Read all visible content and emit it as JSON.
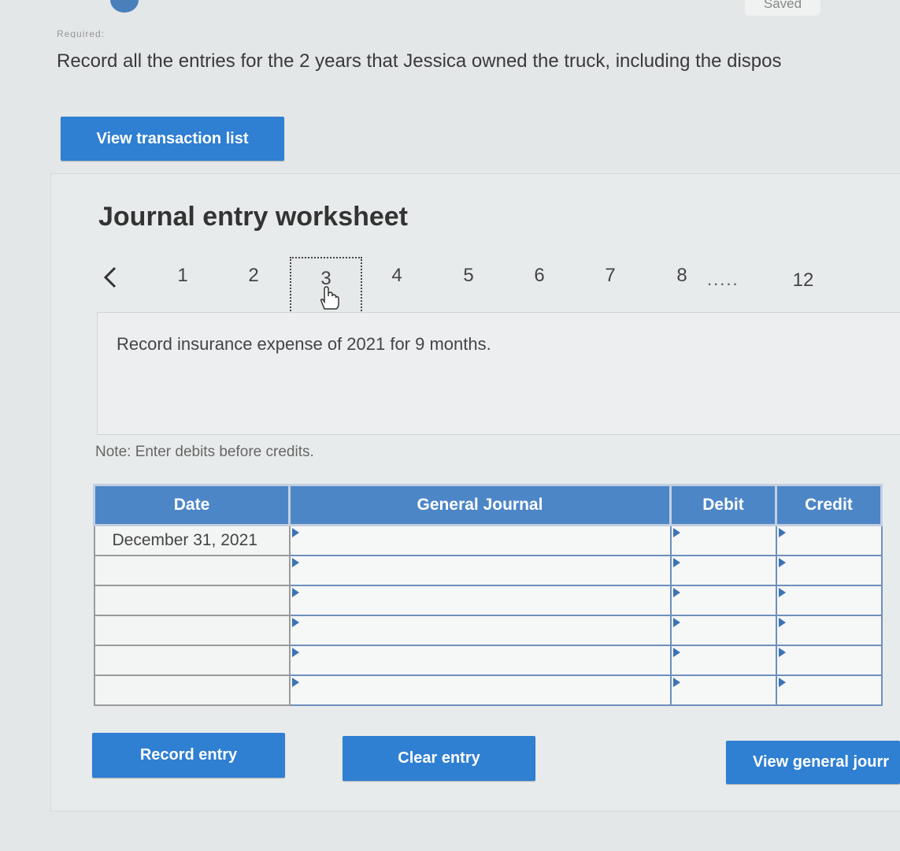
{
  "header": {
    "status": "Saved",
    "required_label": "Required:",
    "instruction": "Record all the entries for the 2 years that Jessica owned the truck, including the dispos"
  },
  "buttons": {
    "view_transaction_list": "View transaction list",
    "record_entry": "Record entry",
    "clear_entry": "Clear entry",
    "view_general_journal": "View general jourr"
  },
  "worksheet": {
    "title": "Journal entry worksheet",
    "pages": [
      "1",
      "2",
      "3",
      "4",
      "5",
      "6",
      "7",
      "8",
      "12"
    ],
    "active_page": "3",
    "ellipsis": ".....",
    "description": "Record insurance expense of 2021 for 9 months.",
    "note": "Note: Enter debits before credits."
  },
  "table": {
    "columns": [
      "Date",
      "General Journal",
      "Debit",
      "Credit"
    ],
    "rows": [
      {
        "date": "December 31, 2021",
        "account": "",
        "debit": "",
        "credit": ""
      },
      {
        "date": "",
        "account": "",
        "debit": "",
        "credit": ""
      },
      {
        "date": "",
        "account": "",
        "debit": "",
        "credit": ""
      },
      {
        "date": "",
        "account": "",
        "debit": "",
        "credit": ""
      },
      {
        "date": "",
        "account": "",
        "debit": "",
        "credit": ""
      },
      {
        "date": "",
        "account": "",
        "debit": "",
        "credit": ""
      }
    ]
  },
  "colors": {
    "primary_button": "#2f7fd3",
    "table_header": "#4d86c7",
    "background": "#e4e7e8"
  }
}
